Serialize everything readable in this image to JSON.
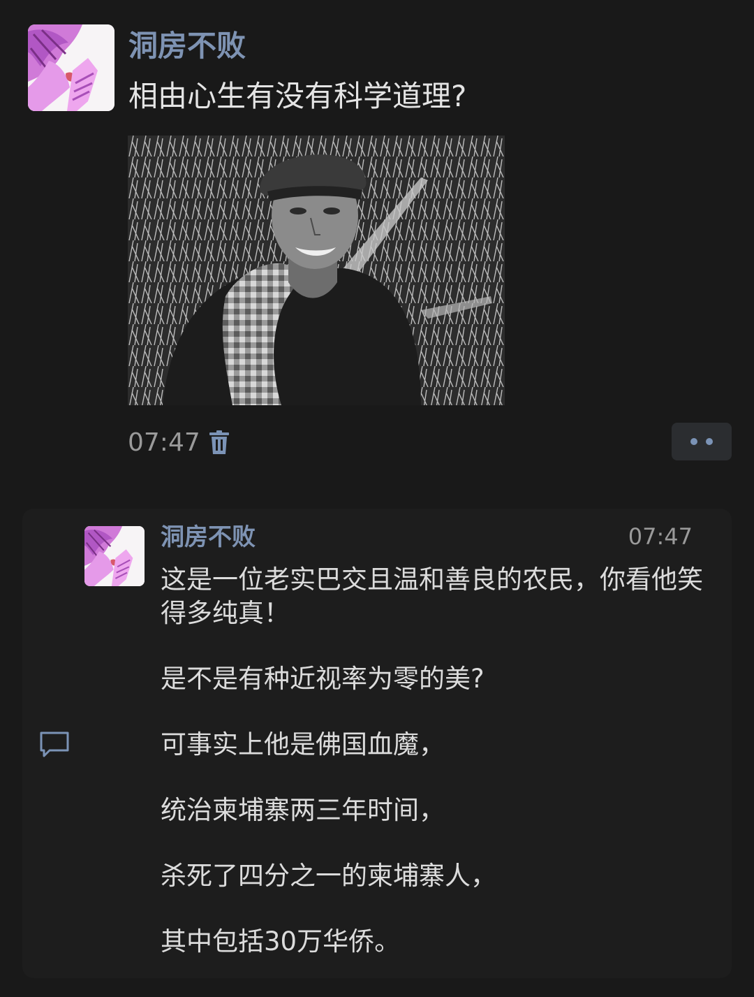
{
  "post": {
    "author": "洞房不败",
    "text": "相由心生有没有科学道理?",
    "time": "07:47"
  },
  "comment": {
    "author": "洞房不败",
    "time": "07:47",
    "lines": [
      "这是一位老实巴交且温和善良的农民，你看他笑得多纯真！",
      "是不是有种近视率为零的美?",
      "可事实上他是佛国血魔，",
      "统治柬埔寨两三年时间，",
      "杀死了四分之一的柬埔寨人，",
      "其中包括30万华侨。"
    ]
  },
  "icons": {
    "delete": "trash-icon",
    "more": "more-dots-icon",
    "reply": "comment-bubble-icon"
  },
  "colors": {
    "background": "#191919",
    "author_name": "#7e93b3",
    "accent_blue": "#7b93b6"
  }
}
